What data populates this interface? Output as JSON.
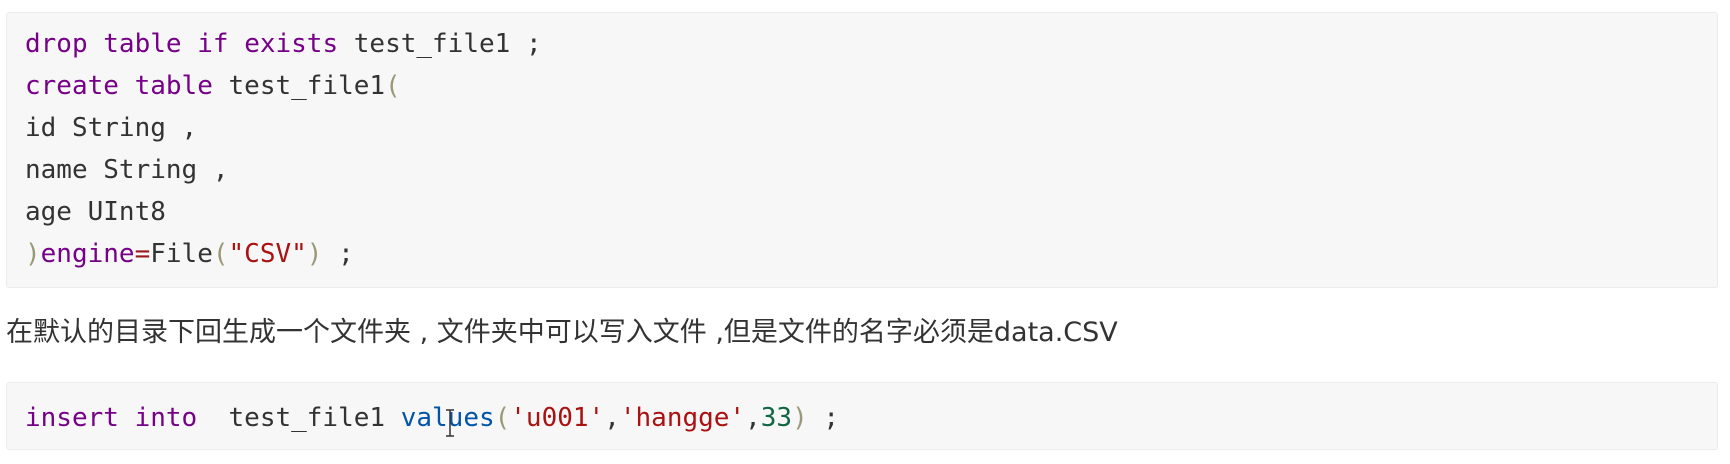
{
  "code_block_1": {
    "line1": {
      "kw1": "drop",
      "kw2": "table",
      "kw3": "if",
      "kw4": "exists",
      "rest": " test_file1 ;"
    },
    "line2": {
      "kw1": "create",
      "kw2": "table",
      "name": " test_file1",
      "paren": "("
    },
    "line3": {
      "text": "id String ,"
    },
    "line4": {
      "text": "name String ,"
    },
    "line5": {
      "text": "age UInt8"
    },
    "line6": {
      "paren_close": ")",
      "engine": "engine",
      "eq": "=",
      "file": "File",
      "paren_open": "(",
      "str": "\"CSV\"",
      "paren_close2": ")",
      "end": " ;"
    }
  },
  "paragraph": {
    "text": "在默认的目录下回生成一个文件夹 , 文件夹中可以写入文件 ,但是文件的名字必须是data.CSV"
  },
  "code_block_2": {
    "kw1": "insert",
    "kw2": "into",
    "table": "  test_file1 ",
    "values_kw": "values",
    "paren_open": "(",
    "str1": "'u001'",
    "comma1": ",",
    "str2": "'hangge'",
    "comma2": ",",
    "num": "33",
    "paren_close": ")",
    "end": " ;"
  },
  "cursor": {
    "icon": "text-cursor-icon"
  }
}
